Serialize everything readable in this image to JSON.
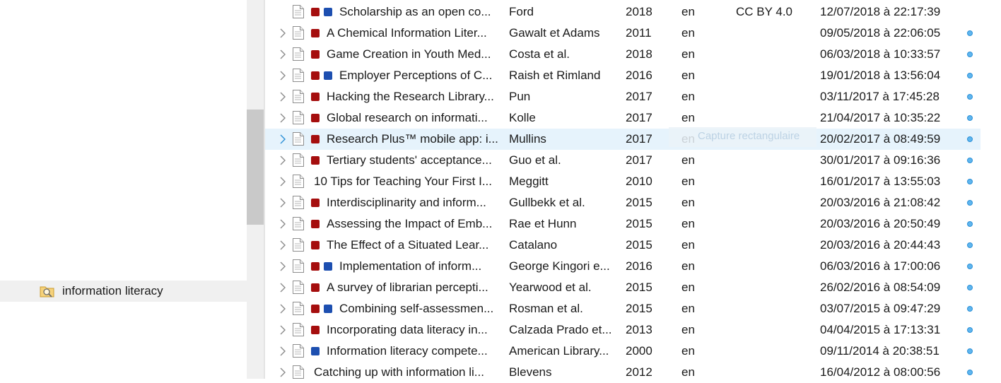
{
  "colors": {
    "tag_red": "#a50e0e",
    "tag_blue": "#1d4fb0",
    "selected_row": "#e6f3fc",
    "indicator": "#5fb6ef"
  },
  "collections": {
    "selected_label": "information literacy",
    "selected_icon": "search-folder-icon"
  },
  "overlay": {
    "label": "Capture rectangulaire"
  },
  "rows": [
    {
      "title": "Scholarship as an open co...",
      "creator": "Ford",
      "year": "2018",
      "lang": "en",
      "rights": "CC BY 4.0",
      "added": "12/07/2018 à 22:17:39",
      "tags": [
        "red",
        "blue"
      ],
      "expand": false,
      "dot": false
    },
    {
      "title": "A Chemical Information Liter...",
      "creator": "Gawalt et Adams",
      "year": "2011",
      "lang": "en",
      "rights": "",
      "added": "09/05/2018 à 22:06:05",
      "tags": [
        "red"
      ],
      "expand": true,
      "dot": true
    },
    {
      "title": "Game Creation in Youth Med...",
      "creator": "Costa et al.",
      "year": "2018",
      "lang": "en",
      "rights": "",
      "added": "06/03/2018 à 10:33:57",
      "tags": [
        "red"
      ],
      "expand": true,
      "dot": true
    },
    {
      "title": "Employer Perceptions of C...",
      "creator": "Raish et Rimland",
      "year": "2016",
      "lang": "en",
      "rights": "",
      "added": "19/01/2018 à 13:56:04",
      "tags": [
        "red",
        "blue"
      ],
      "expand": true,
      "dot": true
    },
    {
      "title": "Hacking the Research Library...",
      "creator": "Pun",
      "year": "2017",
      "lang": "en",
      "rights": "",
      "added": "03/11/2017 à 17:45:28",
      "tags": [
        "red"
      ],
      "expand": true,
      "dot": true
    },
    {
      "title": "Global research on informati...",
      "creator": "Kolle",
      "year": "2017",
      "lang": "en",
      "rights": "",
      "added": "21/04/2017 à 10:35:22",
      "tags": [
        "red"
      ],
      "expand": true,
      "dot": true
    },
    {
      "title": "Research Plus™ mobile app: i...",
      "creator": "Mullins",
      "year": "2017",
      "lang": "en",
      "rights": "",
      "added": "20/02/2017 à 08:49:59",
      "tags": [
        "red"
      ],
      "expand": true,
      "dot": true,
      "selected": true
    },
    {
      "title": "Tertiary students' acceptance...",
      "creator": "Guo et al.",
      "year": "2017",
      "lang": "en",
      "rights": "",
      "added": "30/01/2017 à 09:16:36",
      "tags": [
        "red"
      ],
      "expand": true,
      "dot": true
    },
    {
      "title": "10 Tips for Teaching Your First I...",
      "creator": "Meggitt",
      "year": "2010",
      "lang": "en",
      "rights": "",
      "added": "16/01/2017 à 13:55:03",
      "tags": [],
      "expand": true,
      "dot": true
    },
    {
      "title": "Interdisciplinarity and inform...",
      "creator": "Gullbekk et al.",
      "year": "2015",
      "lang": "en",
      "rights": "",
      "added": "20/03/2016 à 21:08:42",
      "tags": [
        "red"
      ],
      "expand": true,
      "dot": true
    },
    {
      "title": "Assessing the Impact of Emb...",
      "creator": "Rae et Hunn",
      "year": "2015",
      "lang": "en",
      "rights": "",
      "added": "20/03/2016 à 20:50:49",
      "tags": [
        "red"
      ],
      "expand": true,
      "dot": true
    },
    {
      "title": "The Effect of a Situated Lear...",
      "creator": "Catalano",
      "year": "2015",
      "lang": "en",
      "rights": "",
      "added": "20/03/2016 à 20:44:43",
      "tags": [
        "red"
      ],
      "expand": true,
      "dot": true
    },
    {
      "title": "Implementation of inform...",
      "creator": "George Kingori e...",
      "year": "2016",
      "lang": "en",
      "rights": "",
      "added": "06/03/2016 à 17:00:06",
      "tags": [
        "red",
        "blue"
      ],
      "expand": true,
      "dot": true
    },
    {
      "title": "A survey of librarian percepti...",
      "creator": "Yearwood et al.",
      "year": "2015",
      "lang": "en",
      "rights": "",
      "added": "26/02/2016 à 08:54:09",
      "tags": [
        "red"
      ],
      "expand": true,
      "dot": true
    },
    {
      "title": "Combining self-assessmen...",
      "creator": "Rosman et al.",
      "year": "2015",
      "lang": "en",
      "rights": "",
      "added": "03/07/2015 à 09:47:29",
      "tags": [
        "red",
        "blue"
      ],
      "expand": true,
      "dot": true
    },
    {
      "title": "Incorporating data literacy in...",
      "creator": "Calzada Prado et...",
      "year": "2013",
      "lang": "en",
      "rights": "",
      "added": "04/04/2015 à 17:13:31",
      "tags": [
        "red"
      ],
      "expand": true,
      "dot": true
    },
    {
      "title": "Information literacy compete...",
      "creator": "American Library...",
      "year": "2000",
      "lang": "en",
      "rights": "",
      "added": "09/11/2014 à 20:38:51",
      "tags": [
        "blue"
      ],
      "expand": true,
      "dot": true
    },
    {
      "title": "Catching up with information li...",
      "creator": "Blevens",
      "year": "2012",
      "lang": "en",
      "rights": "",
      "added": "16/04/2012 à 08:00:56",
      "tags": [],
      "expand": true,
      "dot": true
    }
  ]
}
